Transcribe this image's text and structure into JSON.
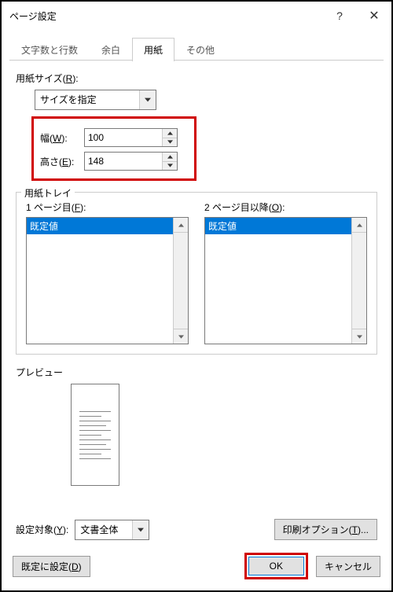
{
  "window": {
    "title": "ページ設定"
  },
  "tabs": {
    "grid": "文字数と行数",
    "margins": "余白",
    "paper": "用紙",
    "other": "その他"
  },
  "paper": {
    "size_label_pre": "用紙サイズ(",
    "size_label_u": "R",
    "size_label_post": "):",
    "size_value": "サイズを指定",
    "width_label_pre": "幅(",
    "width_label_u": "W",
    "width_label_post": "):",
    "width_value": "100",
    "height_label_pre": "高さ(",
    "height_label_u": "E",
    "height_label_post": "):",
    "height_value": "148"
  },
  "tray": {
    "legend": "用紙トレイ",
    "first_label_pre": "1 ページ目(",
    "first_label_u": "F",
    "first_label_post": "):",
    "first_selected": "既定値",
    "other_label_pre": "2 ページ目以降(",
    "other_label_u": "O",
    "other_label_post": "):",
    "other_selected": "既定値"
  },
  "preview": {
    "label": "プレビュー"
  },
  "apply_to": {
    "label_pre": "設定対象(",
    "label_u": "Y",
    "label_post": "):",
    "value": "文書全体"
  },
  "buttons": {
    "print_opts_pre": "印刷オプション(",
    "print_opts_u": "T",
    "print_opts_post": ")...",
    "set_default_pre": "既定に設定(",
    "set_default_u": "D",
    "set_default_post": ")",
    "ok": "OK",
    "cancel": "キャンセル"
  }
}
